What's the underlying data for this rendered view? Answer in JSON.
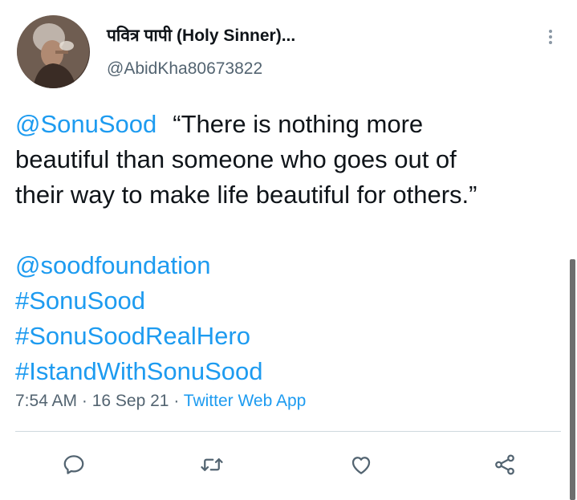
{
  "author": {
    "display_name": "पवित्र पापी (Holy Sinner)...",
    "handle": "@AbidKha80673822"
  },
  "tweet": {
    "mention": "@SonuSood",
    "text_line1": "“There is nothing more",
    "text_line2": "beautiful than someone who goes out of",
    "text_line3": "their way to make life beautiful for others.”",
    "tags": [
      "@soodfoundation",
      "#SonuSood",
      "#SonuSoodRealHero",
      "#IstandWithSonuSood"
    ]
  },
  "meta": {
    "time": "7:54 AM",
    "sep1": " · ",
    "date": "16 Sep 21",
    "sep2": " · ",
    "source": "Twitter Web App"
  },
  "icons": {
    "more": "more-vertical-icon",
    "reply": "reply-icon",
    "retweet": "retweet-icon",
    "like": "heart-icon",
    "share": "share-icon"
  },
  "colors": {
    "link": "#1d9bf0",
    "text": "#0f1419",
    "secondary": "#536471",
    "divider": "#cfd9de"
  }
}
